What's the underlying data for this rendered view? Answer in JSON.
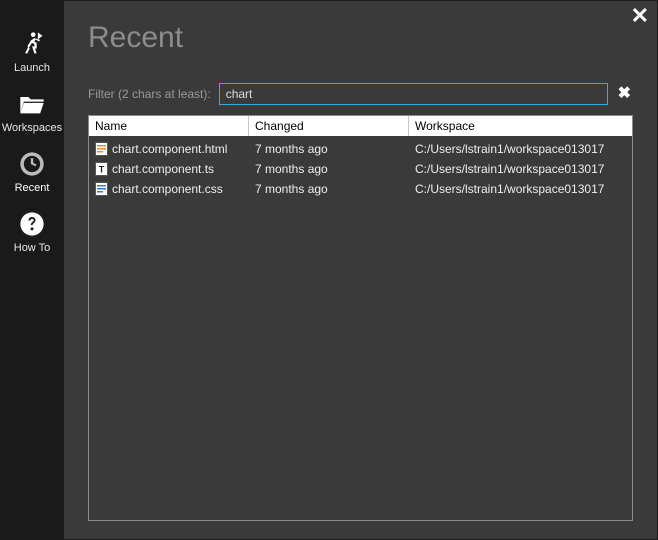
{
  "sidebar": {
    "items": [
      {
        "id": "launch",
        "label": "Launch"
      },
      {
        "id": "workspaces",
        "label": "Workspaces"
      },
      {
        "id": "recent",
        "label": "Recent"
      },
      {
        "id": "howto",
        "label": "How To"
      }
    ],
    "selected": "recent"
  },
  "header": {
    "title": "Recent"
  },
  "filter": {
    "label": "Filter (2 chars at least):",
    "value": "chart"
  },
  "table": {
    "columns": {
      "name": "Name",
      "changed": "Changed",
      "workspace": "Workspace"
    },
    "rows": [
      {
        "icon": "html",
        "name": "chart.component.html",
        "changed": "7 months ago",
        "workspace": "C:/Users/lstrain1/workspace013017"
      },
      {
        "icon": "ts",
        "name": "chart.component.ts",
        "changed": "7 months ago",
        "workspace": "C:/Users/lstrain1/workspace013017"
      },
      {
        "icon": "css",
        "name": "chart.component.css",
        "changed": "7 months ago",
        "workspace": "C:/Users/lstrain1/workspace013017"
      }
    ]
  }
}
